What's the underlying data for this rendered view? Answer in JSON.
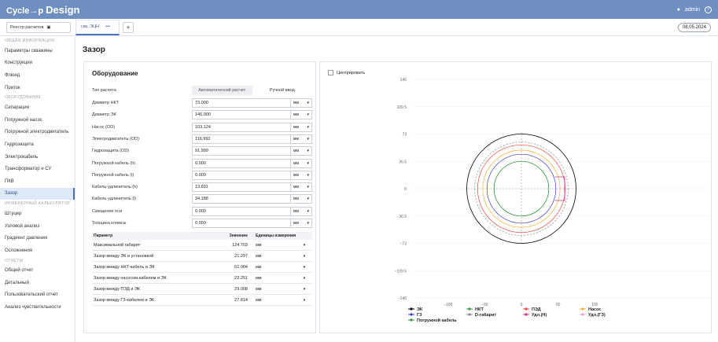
{
  "app": {
    "logo": "Cycle→p",
    "logo_suffix": "Design",
    "user": "admin",
    "help": "?"
  },
  "subbar": {
    "registry_label": "Реестр расчетов",
    "tab_label": "скв. ЭЦН",
    "tab_more": "•••",
    "add": "+",
    "date": "08.05.2024"
  },
  "sidebar": [
    {
      "type": "section",
      "label": "ОБЩАЯ ИНФОРМАЦИЯ"
    },
    {
      "type": "item",
      "label": "Параметры скважины"
    },
    {
      "type": "item",
      "label": "Конструкция"
    },
    {
      "type": "item",
      "label": "Флюид"
    },
    {
      "type": "item",
      "label": "Приток"
    },
    {
      "type": "section",
      "label": "ОБОРУДОВАНИЕ"
    },
    {
      "type": "item",
      "label": "Сепарация"
    },
    {
      "type": "item",
      "label": "Погружной насос"
    },
    {
      "type": "item",
      "label": "Погружной электродвигатель"
    },
    {
      "type": "item",
      "label": "Гидрозащита"
    },
    {
      "type": "item",
      "label": "Электрокабель"
    },
    {
      "type": "item",
      "label": "Трансформатор и СУ"
    },
    {
      "type": "item",
      "label": "ПКВ"
    },
    {
      "type": "item",
      "label": "Зазор",
      "active": true
    },
    {
      "type": "section",
      "label": "ИНЖЕНЕРНЫЙ КАЛЬКУЛЯТОР"
    },
    {
      "type": "item",
      "label": "Штуцер"
    },
    {
      "type": "item",
      "label": "Узловой анализ"
    },
    {
      "type": "item",
      "label": "Градиент давления"
    },
    {
      "type": "item",
      "label": "Осложнения"
    },
    {
      "type": "section",
      "label": "ОТЧЕТЫ"
    },
    {
      "type": "item",
      "label": "Общий отчет"
    },
    {
      "type": "item",
      "label": "Детальный"
    },
    {
      "type": "item",
      "label": "Пользовательский отчет"
    },
    {
      "type": "item",
      "label": "Анализ чувствительности"
    }
  ],
  "page_title": "Зазор",
  "equipment": {
    "title": "Оборудование",
    "calc_type_label": "Тип расчета",
    "calc_modes": [
      "Автоматический расчет",
      "Ручной ввод"
    ],
    "unit_value": "мм",
    "fields": [
      {
        "label": "Диаметр НКТ",
        "value": "73.000"
      },
      {
        "label": "Диаметр ЭК",
        "value": "146.000"
      },
      {
        "label": "Насос (OD)",
        "value": "103.124"
      },
      {
        "label": "Электродвигатель (OD)",
        "value": "116.992"
      },
      {
        "label": "Гидрозащита (OD)",
        "value": "91.999"
      },
      {
        "label": "Погружной кабель (h)",
        "value": "0.000"
      },
      {
        "label": "Погружной кабель (l)",
        "value": "0.000"
      },
      {
        "label": "Кабель-удлинитель (h)",
        "value": "13.691"
      },
      {
        "label": "Кабель-удлинитель (l)",
        "value": "34.188"
      },
      {
        "label": "Смещение оси",
        "value": "0.000"
      },
      {
        "label": "Толщина клямсы",
        "value": "0.000"
      }
    ]
  },
  "results": {
    "headers": [
      "Параметр",
      "Значение",
      "Единицы измерения"
    ],
    "rows": [
      {
        "param": "Максимальной габарит",
        "value": "124.703",
        "unit": "мм"
      },
      {
        "param": "Зазор между ЭК и установкой",
        "value": "21.297",
        "unit": "мм"
      },
      {
        "param": "Зазор между НКТ-кабель и ЭК",
        "value": "51.004",
        "unit": "мм"
      },
      {
        "param": "Зазор между насосом-кабелем и ЭК",
        "value": "22.251",
        "unit": "мм"
      },
      {
        "param": "Зазор между ПЭД и ЭК",
        "value": "29.008",
        "unit": "мм"
      },
      {
        "param": "Зазор между ГЗ-кабелем и ЭК",
        "value": "27.814",
        "unit": "мм"
      }
    ]
  },
  "chart_panel": {
    "center_label": "Центрировать"
  },
  "chart_data": {
    "type": "scatter",
    "y_ticks": [
      "146",
      "109.5",
      "73",
      "36.5",
      "0",
      "−36.5",
      "−73",
      "−109.5",
      "−146"
    ],
    "x_ticks": [
      "−100",
      "−50",
      "0",
      "50",
      "100"
    ],
    "xlim": [
      -146,
      146
    ],
    "ylim": [
      -146,
      146
    ],
    "series": [
      {
        "name": "ЭК",
        "diameter": 146.0,
        "color": "#000000"
      },
      {
        "name": "НКТ",
        "diameter": 73.0,
        "color": "#2e9b3a"
      },
      {
        "name": "ПЭД",
        "diameter": 116.992,
        "color": "#e8463a"
      },
      {
        "name": "Насос",
        "diameter": 103.124,
        "color": "#f0b02e"
      },
      {
        "name": "ГЗ",
        "diameter": 91.999,
        "color": "#3a3ad0"
      },
      {
        "name": "D-габарит",
        "diameter": 124.703,
        "color": "#888888"
      },
      {
        "name": "Удл.(Н)",
        "diameter": 0,
        "color": "#d0308a"
      },
      {
        "name": "Удл.(ГЗ)",
        "diameter": 0,
        "color": "#f0a0d0"
      },
      {
        "name": "Погружной кабель",
        "diameter": 0,
        "color": "#2e9b3a"
      }
    ]
  }
}
